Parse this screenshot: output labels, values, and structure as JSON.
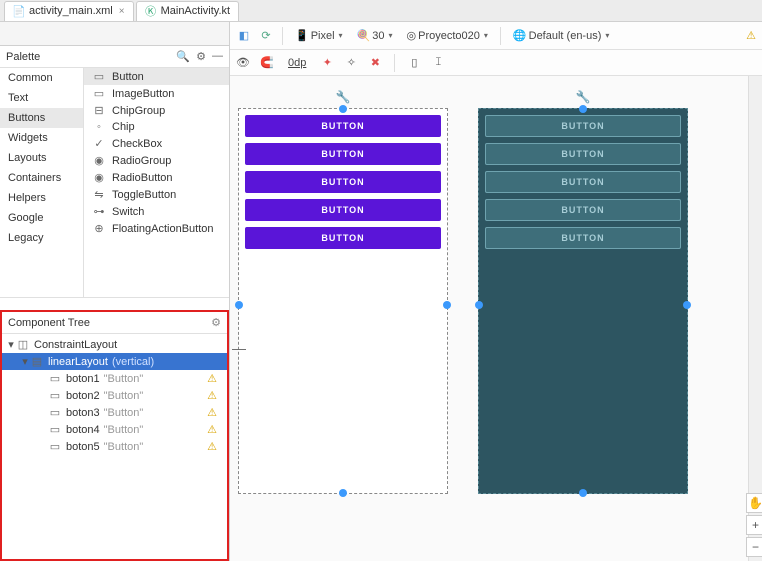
{
  "tabs": [
    {
      "label": "activity_main.xml",
      "icon": "xml"
    },
    {
      "label": "MainActivity.kt",
      "icon": "kt"
    }
  ],
  "palette": {
    "title": "Palette",
    "categories": [
      "Common",
      "Text",
      "Buttons",
      "Widgets",
      "Layouts",
      "Containers",
      "Helpers",
      "Google",
      "Legacy"
    ],
    "selected_category": "Buttons",
    "widgets": [
      {
        "icon": "▭",
        "label": "Button",
        "sel": true
      },
      {
        "icon": "▭",
        "label": "ImageButton"
      },
      {
        "icon": "⊟",
        "label": "ChipGroup"
      },
      {
        "icon": "◦",
        "label": "Chip"
      },
      {
        "icon": "✓",
        "label": "CheckBox"
      },
      {
        "icon": "◉",
        "label": "RadioGroup"
      },
      {
        "icon": "◉",
        "label": "RadioButton"
      },
      {
        "icon": "⇋",
        "label": "ToggleButton"
      },
      {
        "icon": "⊶",
        "label": "Switch"
      },
      {
        "icon": "⊕",
        "label": "FloatingActionButton"
      }
    ]
  },
  "component_tree": {
    "title": "Component Tree",
    "root": "ConstraintLayout",
    "child": {
      "label": "linearLayout",
      "hint": "(vertical)"
    },
    "buttons": [
      {
        "name": "boton1",
        "hint": "\"Button\""
      },
      {
        "name": "boton2",
        "hint": "\"Button\""
      },
      {
        "name": "boton3",
        "hint": "\"Button\""
      },
      {
        "name": "boton4",
        "hint": "\"Button\""
      },
      {
        "name": "boton5",
        "hint": "\"Button\""
      }
    ]
  },
  "toolbar": {
    "device": "Pixel",
    "api": "30",
    "app": "Proyecto020",
    "locale": "Default (en-us)",
    "dp": "0dp"
  },
  "preview": {
    "button_label": "BUTTON",
    "button_count": 5
  },
  "colors": {
    "accent_purple": "#5a15d8",
    "blueprint_bg": "#2d5561"
  }
}
